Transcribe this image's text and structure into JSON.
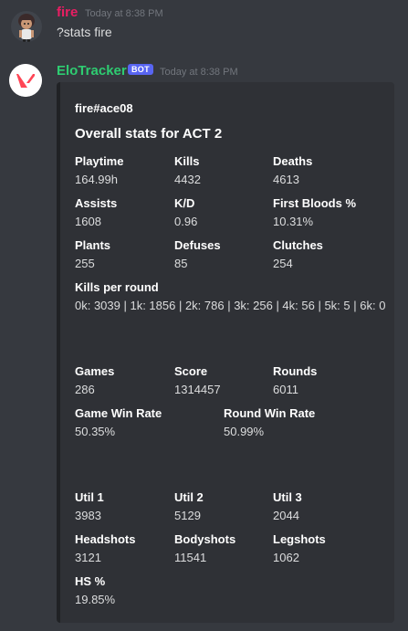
{
  "messages": [
    {
      "author": "fire",
      "author_color": "#e91e63",
      "timestamp": "Today at 8:38 PM",
      "text": "?stats fire",
      "avatar": "chibi-character-avatar-icon"
    },
    {
      "author": "EloTracker",
      "author_color": "#2ecc71",
      "bot_tag": "BOT",
      "timestamp": "Today at 8:38 PM",
      "avatar": "valorant-logo-icon",
      "embed": {
        "author": "fire#ace08",
        "title": "Overall stats for ACT 2",
        "border_color": "#202225",
        "fields": {
          "playtime": {
            "name": "Playtime",
            "value": "164.99h"
          },
          "kills": {
            "name": "Kills",
            "value": "4432"
          },
          "deaths": {
            "name": "Deaths",
            "value": "4613"
          },
          "assists": {
            "name": "Assists",
            "value": "1608"
          },
          "kd": {
            "name": "K/D",
            "value": "0.96"
          },
          "first_bloods": {
            "name": "First Bloods %",
            "value": "10.31%"
          },
          "plants": {
            "name": "Plants",
            "value": "255"
          },
          "defuses": {
            "name": "Defuses",
            "value": "85"
          },
          "clutches": {
            "name": "Clutches",
            "value": "254"
          },
          "kills_per_round": {
            "name": "Kills per round",
            "value": "0k: 3039 | 1k: 1856 | 2k: 786 | 3k: 256 | 4k: 56 | 5k: 5 | 6k: 0"
          },
          "games": {
            "name": "Games",
            "value": "286"
          },
          "score": {
            "name": "Score",
            "value": "1314457"
          },
          "rounds": {
            "name": "Rounds",
            "value": "6011"
          },
          "game_win_rate": {
            "name": "Game Win Rate",
            "value": "50.35%"
          },
          "round_win_rate": {
            "name": "Round Win Rate",
            "value": "50.99%"
          },
          "util1": {
            "name": "Util 1",
            "value": "3983"
          },
          "util2": {
            "name": "Util 2",
            "value": "5129"
          },
          "util3": {
            "name": "Util 3",
            "value": "2044"
          },
          "headshots": {
            "name": "Headshots",
            "value": "3121"
          },
          "bodyshots": {
            "name": "Bodyshots",
            "value": "11541"
          },
          "legshots": {
            "name": "Legshots",
            "value": "1062"
          },
          "hs_pct": {
            "name": "HS %",
            "value": "19.85%"
          }
        }
      }
    }
  ]
}
